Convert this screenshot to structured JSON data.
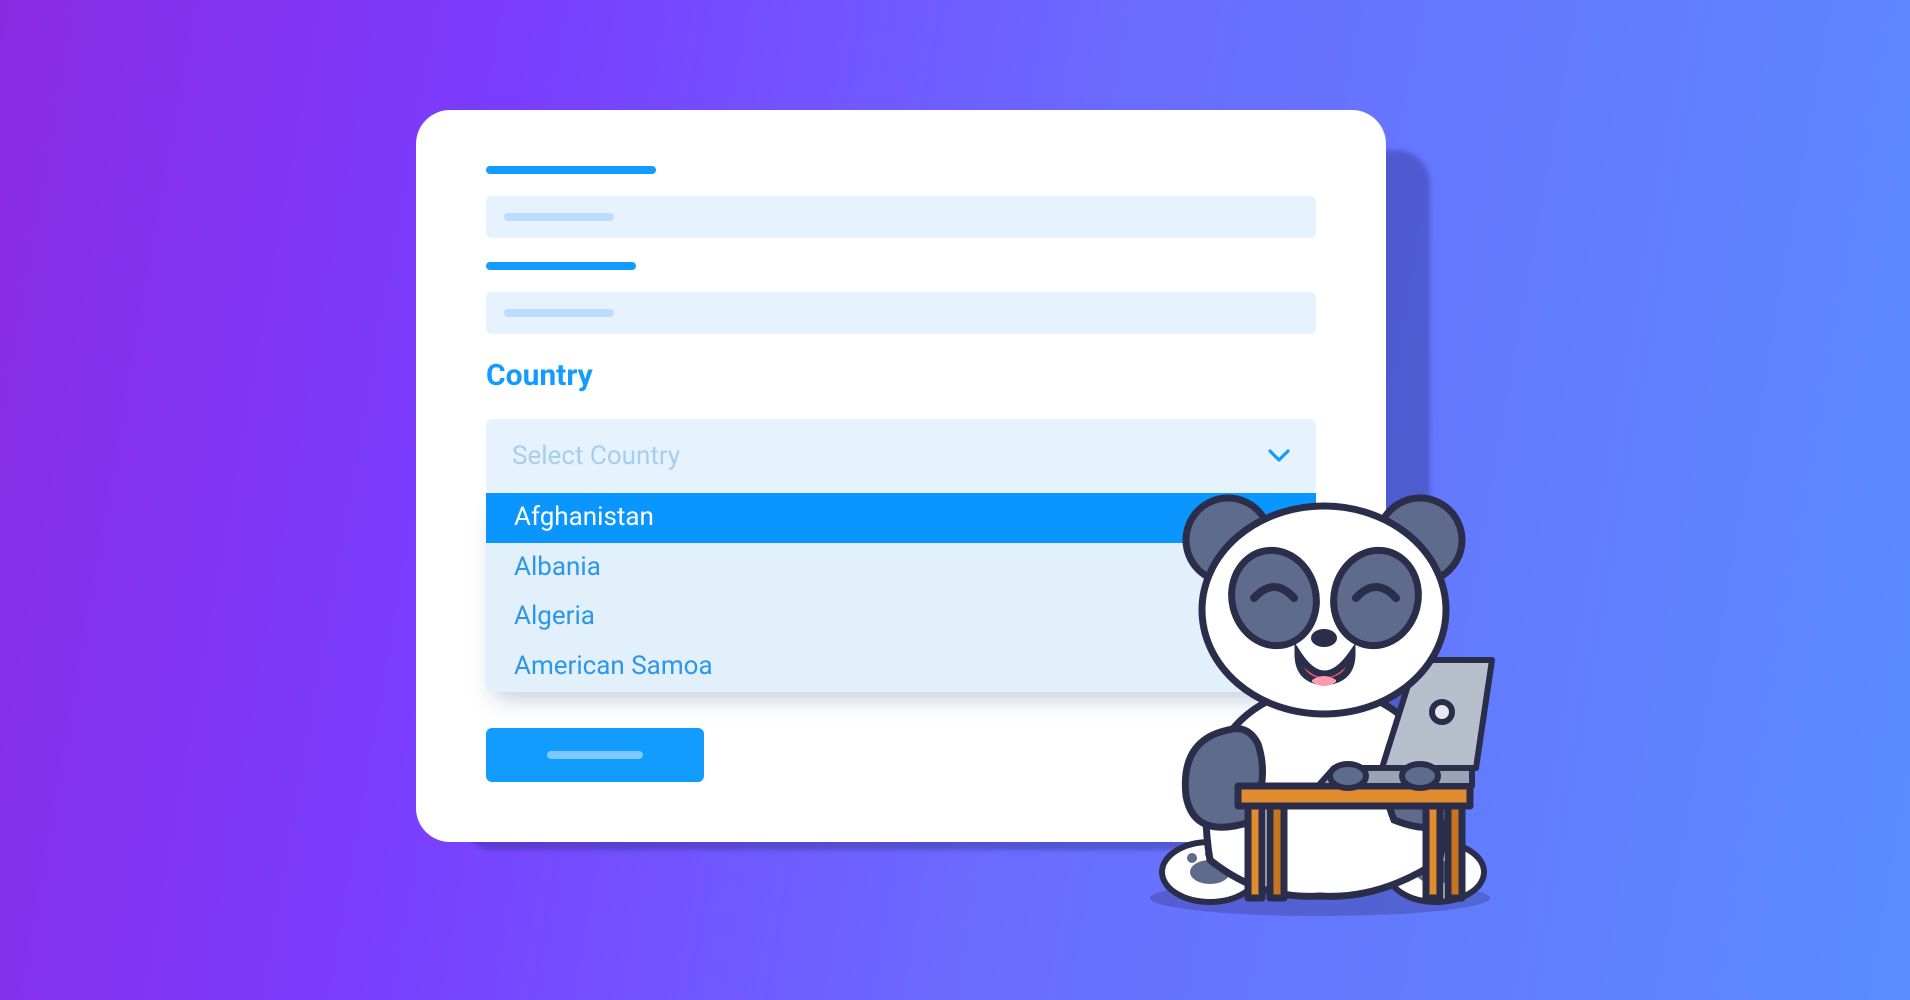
{
  "form": {
    "country": {
      "label": "Country",
      "placeholder": "Select Country",
      "options": [
        "Afghanistan",
        "Albania",
        "Algeria",
        "American Samoa"
      ],
      "highlighted_index": 0
    }
  },
  "illustration": "panda-with-laptop"
}
